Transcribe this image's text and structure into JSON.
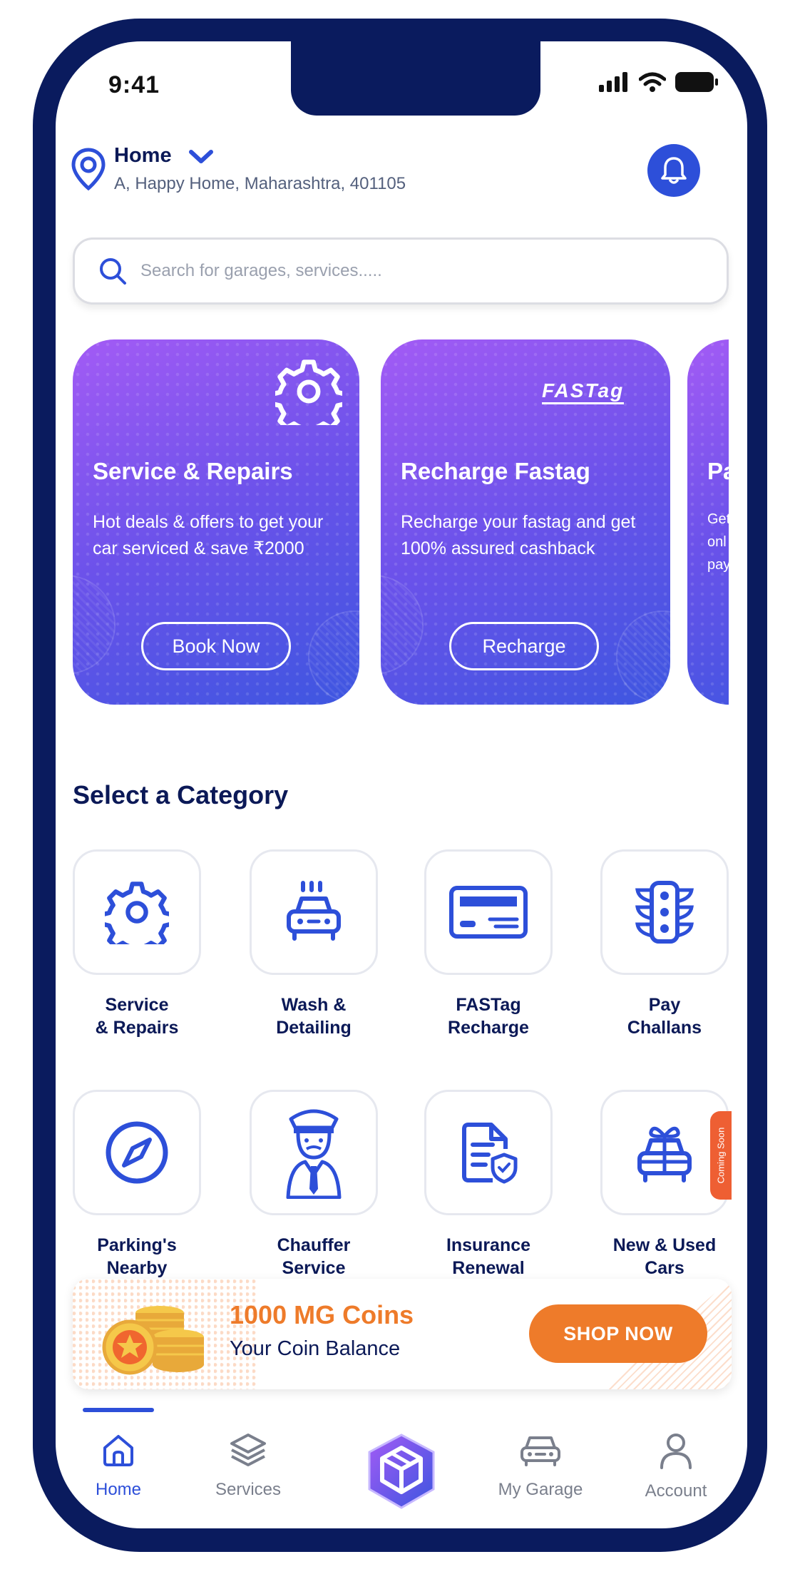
{
  "status_bar": {
    "time": "9:41"
  },
  "location": {
    "title": "Home",
    "address": "A, Happy Home, Maharashtra, 401105"
  },
  "search": {
    "placeholder": "Search for garages, services....."
  },
  "promos": [
    {
      "title": "Service &  Repairs",
      "description": "Hot deals & offers to get your car serviced & save ₹2000",
      "button": "Book Now",
      "icon": "gear-icon"
    },
    {
      "title": "Recharge Fastag",
      "description": "Recharge your fastag and get 100% assured cashback",
      "button": "Recharge",
      "icon": "fastag-logo",
      "logo_text": "FASTag"
    },
    {
      "title": "Pa",
      "description": "Get onl pay",
      "icon": ""
    }
  ],
  "category": {
    "heading": "Select a Category",
    "items": [
      {
        "label": "Service\n& Repairs",
        "icon": "gear-icon"
      },
      {
        "label": "Wash &\nDetailing",
        "icon": "car-wash-icon"
      },
      {
        "label": "FASTag\nRecharge",
        "icon": "fastag-card-icon"
      },
      {
        "label": "Pay\nChallans",
        "icon": "traffic-light-icon"
      },
      {
        "label": "Parking's\nNearby",
        "icon": "compass-icon"
      },
      {
        "label": "Chauffer\nService",
        "icon": "chauffeur-icon"
      },
      {
        "label": "Insurance\nRenewal",
        "icon": "insurance-document-icon"
      },
      {
        "label": "New & Used\nCars",
        "icon": "gift-car-icon",
        "badge": "Coming Soon"
      }
    ]
  },
  "coins": {
    "amount": "1000 MG Coins",
    "subtitle": "Your Coin Balance",
    "button": "SHOP NOW"
  },
  "bottom_nav": {
    "items": [
      {
        "label": "Home",
        "icon": "home-icon",
        "active": true
      },
      {
        "label": "Services",
        "icon": "layers-icon",
        "active": false
      },
      {
        "label": "",
        "icon": "brand-cube-icon",
        "active": false
      },
      {
        "label": "My Garage",
        "icon": "car-icon",
        "active": false
      },
      {
        "label": "Account",
        "icon": "user-icon",
        "active": false
      }
    ]
  },
  "colors": {
    "frame": "#0a1b5e",
    "primary": "#2d4fd9",
    "heading": "#0b1957",
    "accent_orange": "#ee7b2a",
    "badge_red": "#ee5f33",
    "promo_gradient_start": "#a35bf5",
    "promo_gradient_end": "#3d56e0"
  }
}
